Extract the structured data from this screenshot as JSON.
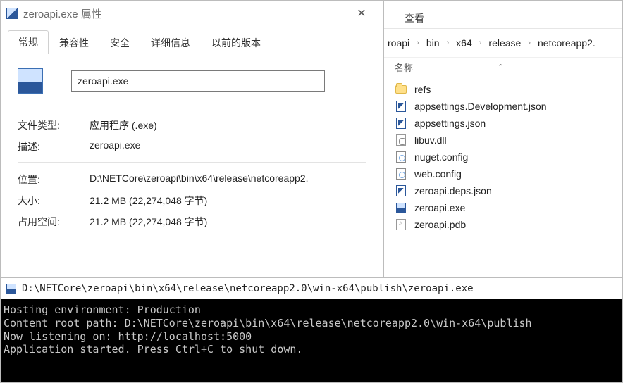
{
  "properties": {
    "title": "zeroapi.exe 属性",
    "tabs": [
      "常规",
      "兼容性",
      "安全",
      "详细信息",
      "以前的版本"
    ],
    "active_tab_index": 0,
    "filename": "zeroapi.exe",
    "rows": {
      "file_type": {
        "label": "文件类型:",
        "value": "应用程序 (.exe)"
      },
      "description": {
        "label": "描述:",
        "value": "zeroapi.exe"
      },
      "location": {
        "label": "位置:",
        "value": "D:\\NETCore\\zeroapi\\bin\\x64\\release\\netcoreapp2."
      },
      "size": {
        "label": "大小:",
        "value": "21.2 MB (22,274,048 字节)"
      },
      "size_on_disk": {
        "label": "占用空间:",
        "value": "21.2 MB (22,274,048 字节)"
      }
    }
  },
  "explorer": {
    "view_tab": "查看",
    "breadcrumb": [
      "roapi",
      "bin",
      "x64",
      "release",
      "netcoreapp2."
    ],
    "col_name": "名称",
    "sort_indicator": "⌃",
    "items": [
      {
        "icon": "folder",
        "name": "refs"
      },
      {
        "icon": "json",
        "name": "appsettings.Development.json"
      },
      {
        "icon": "json",
        "name": "appsettings.json"
      },
      {
        "icon": "dll",
        "name": "libuv.dll"
      },
      {
        "icon": "config",
        "name": "nuget.config"
      },
      {
        "icon": "config",
        "name": "web.config"
      },
      {
        "icon": "json",
        "name": "zeroapi.deps.json"
      },
      {
        "icon": "exe",
        "name": "zeroapi.exe"
      },
      {
        "icon": "pdb",
        "name": "zeroapi.pdb"
      }
    ]
  },
  "console": {
    "title": "D:\\NETCore\\zeroapi\\bin\\x64\\release\\netcoreapp2.0\\win-x64\\publish\\zeroapi.exe",
    "lines": [
      "Hosting environment: Production",
      "Content root path: D:\\NETCore\\zeroapi\\bin\\x64\\release\\netcoreapp2.0\\win-x64\\publish",
      "Now listening on: http://localhost:5000",
      "Application started. Press Ctrl+C to shut down."
    ]
  }
}
